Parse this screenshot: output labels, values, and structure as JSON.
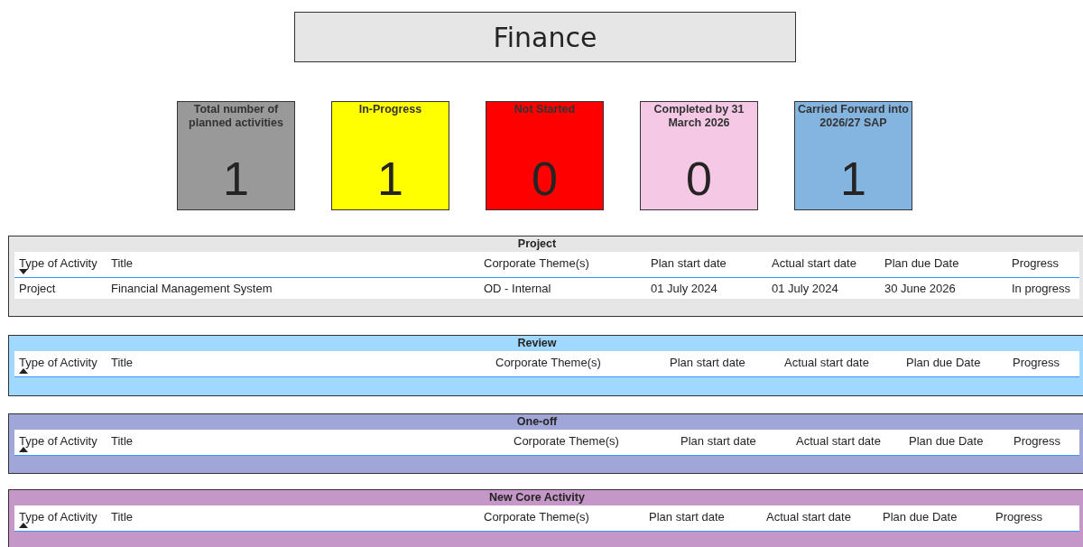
{
  "title": "Finance",
  "cards": [
    {
      "label": "Total number of planned activities",
      "value": "1",
      "color": "#999999"
    },
    {
      "label": "In-Progress",
      "value": "1",
      "color": "#ffff00"
    },
    {
      "label": "Not Started",
      "value": "0",
      "color": "#ff0000"
    },
    {
      "label": "Completed by 31 March 2026",
      "value": "0",
      "color": "#f5c9e6"
    },
    {
      "label": "Carried Forward into 2026/27 SAP",
      "value": "1",
      "color": "#84b4e0"
    }
  ],
  "sections": [
    {
      "title": "Project",
      "color": "#e6e6e6",
      "sort_descending": true,
      "columns": [
        "Type of Activity",
        "Title",
        "Corporate Theme(s)",
        "Plan start date",
        "Actual start date",
        "Plan due Date",
        "Progress"
      ],
      "rows": [
        [
          "Project",
          "Financial Management System",
          "OD - Internal",
          "01 July 2024",
          "01 July 2024",
          "30 June 2026",
          "In progress"
        ]
      ]
    },
    {
      "title": "Review",
      "color": "#a0d8ff",
      "sort_descending": false,
      "columns": [
        "Type of Activity",
        "Title",
        "Corporate Theme(s)",
        "Plan start date",
        "Actual start date",
        "Plan due Date",
        "Progress"
      ]
    },
    {
      "title": "One-off",
      "color": "#a0a6d8",
      "sort_descending": false,
      "columns": [
        "Type of Activity",
        "Title",
        "Corporate Theme(s)",
        "Plan start date",
        "Actual start date",
        "Plan due Date",
        "Progress"
      ]
    },
    {
      "title": "New Core Activity",
      "color": "#c497c8",
      "sort_descending": false,
      "columns": [
        "Type of Activity",
        "Title",
        "Corporate Theme(s)",
        "Plan start date",
        "Actual start date",
        "Plan due Date",
        "Progress"
      ]
    }
  ]
}
